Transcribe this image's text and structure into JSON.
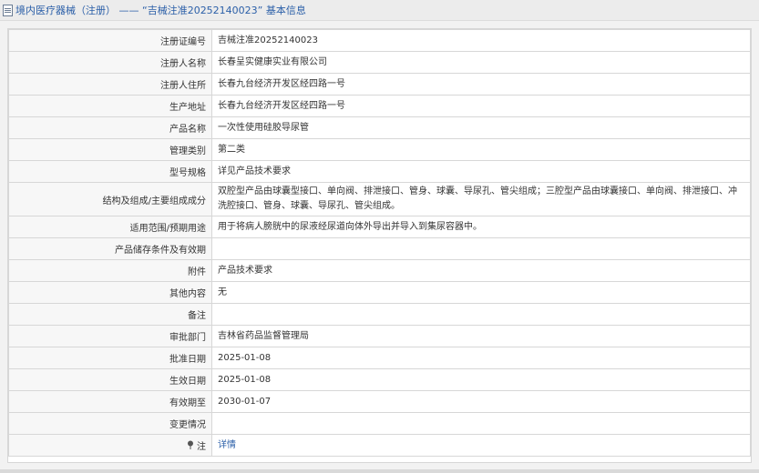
{
  "header": {
    "breadcrumb": "境内医疗器械（注册） —— “吉械注准20252140023” 基本信息"
  },
  "rows": [
    {
      "label": "注册证编号",
      "value": "吉械注准20252140023"
    },
    {
      "label": "注册人名称",
      "value": "长春呈实健康实业有限公司"
    },
    {
      "label": "注册人住所",
      "value": "长春九台经济开发区经四路一号"
    },
    {
      "label": "生产地址",
      "value": "长春九台经济开发区经四路一号"
    },
    {
      "label": "产品名称",
      "value": "一次性使用硅胶导尿管"
    },
    {
      "label": "管理类别",
      "value": "第二类"
    },
    {
      "label": "型号规格",
      "value": "详见产品技术要求"
    },
    {
      "label": "结构及组成/主要组成成分",
      "value": "双腔型产品由球囊型接口、单向阀、排泄接口、管身、球囊、导尿孔、管尖组成；三腔型产品由球囊接口、单向阀、排泄接口、冲洗腔接口、管身、球囊、导尿孔、管尖组成。"
    },
    {
      "label": "适用范围/预期用途",
      "value": "用于将病人膀胱中的尿液经尿道向体外导出并导入到集尿容器中。"
    },
    {
      "label": "产品储存条件及有效期",
      "value": ""
    },
    {
      "label": "附件",
      "value": "产品技术要求"
    },
    {
      "label": "其他内容",
      "value": "无"
    },
    {
      "label": "备注",
      "value": ""
    },
    {
      "label": "审批部门",
      "value": "吉林省药品监督管理局"
    },
    {
      "label": "批准日期",
      "value": "2025-01-08"
    },
    {
      "label": "生效日期",
      "value": "2025-01-08"
    },
    {
      "label": "有效期至",
      "value": "2030-01-07"
    },
    {
      "label": "变更情况",
      "value": ""
    },
    {
      "label": "注",
      "value": "详情"
    }
  ]
}
